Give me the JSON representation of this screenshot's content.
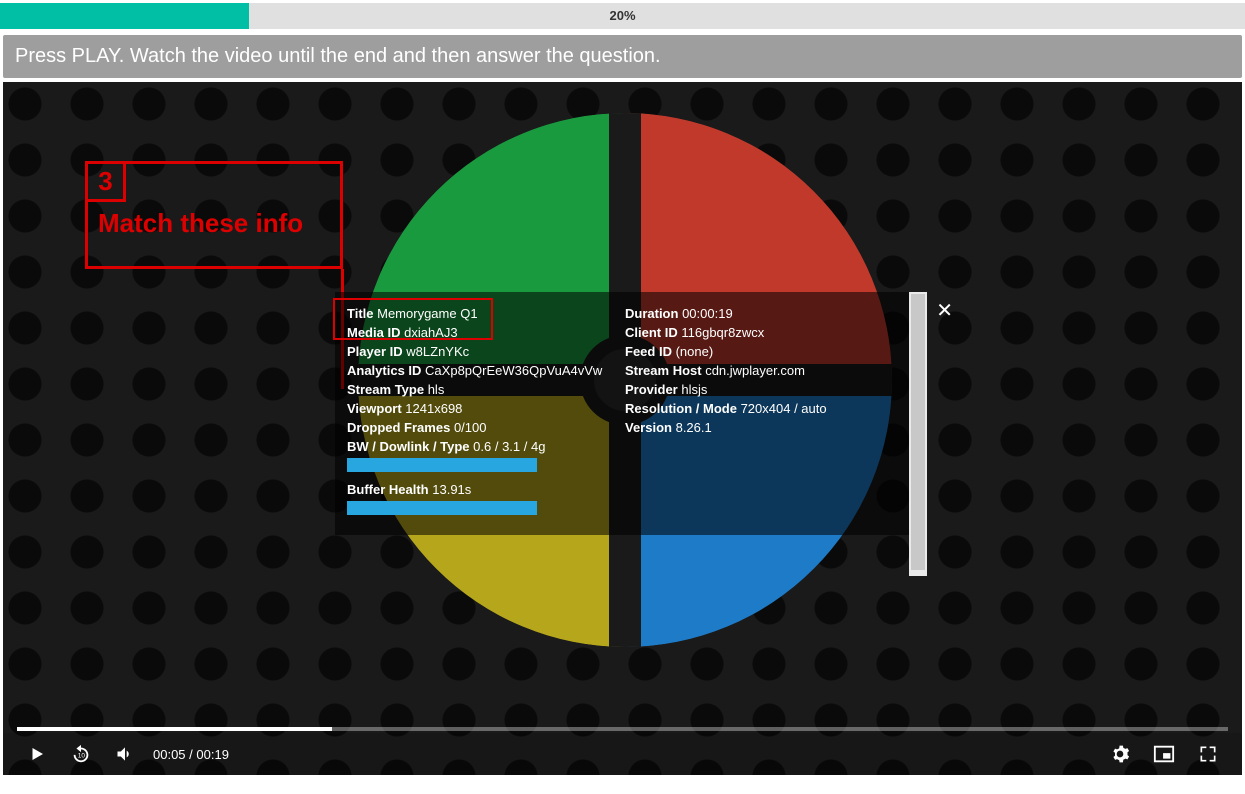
{
  "progress": {
    "percent": 20,
    "label": "20%"
  },
  "instruction": "Press PLAY. Watch the video until the end and then answer the question.",
  "callout": {
    "number": "3",
    "text": "Match these info"
  },
  "debug": {
    "left": [
      {
        "label": "Title",
        "value": "Memorygame Q1"
      },
      {
        "label": "Media ID",
        "value": "dxiahAJ3"
      },
      {
        "label": "Player ID",
        "value": "w8LZnYKc"
      },
      {
        "label": "Analytics ID",
        "value": "CaXp8pQrEeW36QpVuA4vVw"
      },
      {
        "label": "Stream Type",
        "value": "hls"
      },
      {
        "label": "Viewport",
        "value": "1241x698"
      },
      {
        "label": "Dropped Frames",
        "value": "0/100"
      },
      {
        "label": "BW / Dowlink / Type",
        "value": "0.6 / 3.1 / 4g"
      }
    ],
    "right": [
      {
        "label": "Duration",
        "value": "00:00:19"
      },
      {
        "label": "Client ID",
        "value": "116gbqr8zwcx"
      },
      {
        "label": "Feed ID",
        "value": "(none)"
      },
      {
        "label": "Stream Host",
        "value": "cdn.jwplayer.com"
      },
      {
        "label": "Provider",
        "value": "hlsjs"
      },
      {
        "label": "Resolution / Mode",
        "value": "720x404 / auto"
      },
      {
        "label": "Version",
        "value": "8.26.1"
      }
    ],
    "buffer": {
      "label": "Buffer Health",
      "value": "13.91s"
    }
  },
  "player": {
    "elapsed": "00:05",
    "separator": "/",
    "total": "00:19"
  }
}
